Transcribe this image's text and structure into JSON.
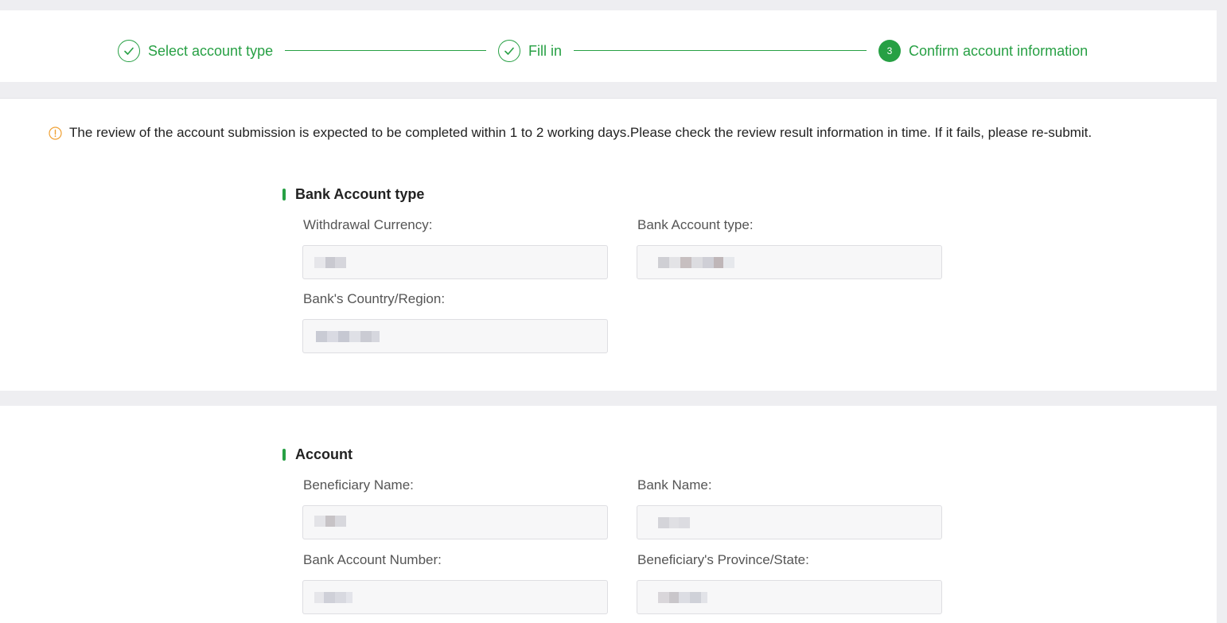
{
  "steps": [
    {
      "label": "Select account type",
      "status": "done"
    },
    {
      "label": "Fill in",
      "status": "done"
    },
    {
      "label": "Confirm account information",
      "status": "active",
      "number": "3"
    }
  ],
  "notice": {
    "icon": "warning-circle-icon",
    "text": "The review of the account submission is expected to be completed within 1 to 2 working days.Please check the review result information in time. If it fails, please re-submit."
  },
  "sections": {
    "bank_account_type": {
      "title": "Bank Account type",
      "fields": {
        "withdrawal_currency": {
          "label": "Withdrawal Currency:",
          "value": ""
        },
        "bank_account_type": {
          "label": "Bank Account type:",
          "value": ""
        },
        "bank_country_region": {
          "label": "Bank's Country/Region:",
          "value": ""
        }
      }
    },
    "account": {
      "title": "Account",
      "fields": {
        "beneficiary_name": {
          "label": "Beneficiary Name:",
          "value": ""
        },
        "bank_name": {
          "label": "Bank Name:",
          "value": ""
        },
        "bank_account_number": {
          "label": "Bank Account Number:",
          "value": ""
        },
        "beneficiary_province_state": {
          "label": "Beneficiary's Province/State:",
          "value": ""
        }
      }
    }
  },
  "colors": {
    "accent": "#27a044",
    "warning": "#f0a033",
    "background": "#eeeef1",
    "field_bg": "#f7f7f8"
  }
}
